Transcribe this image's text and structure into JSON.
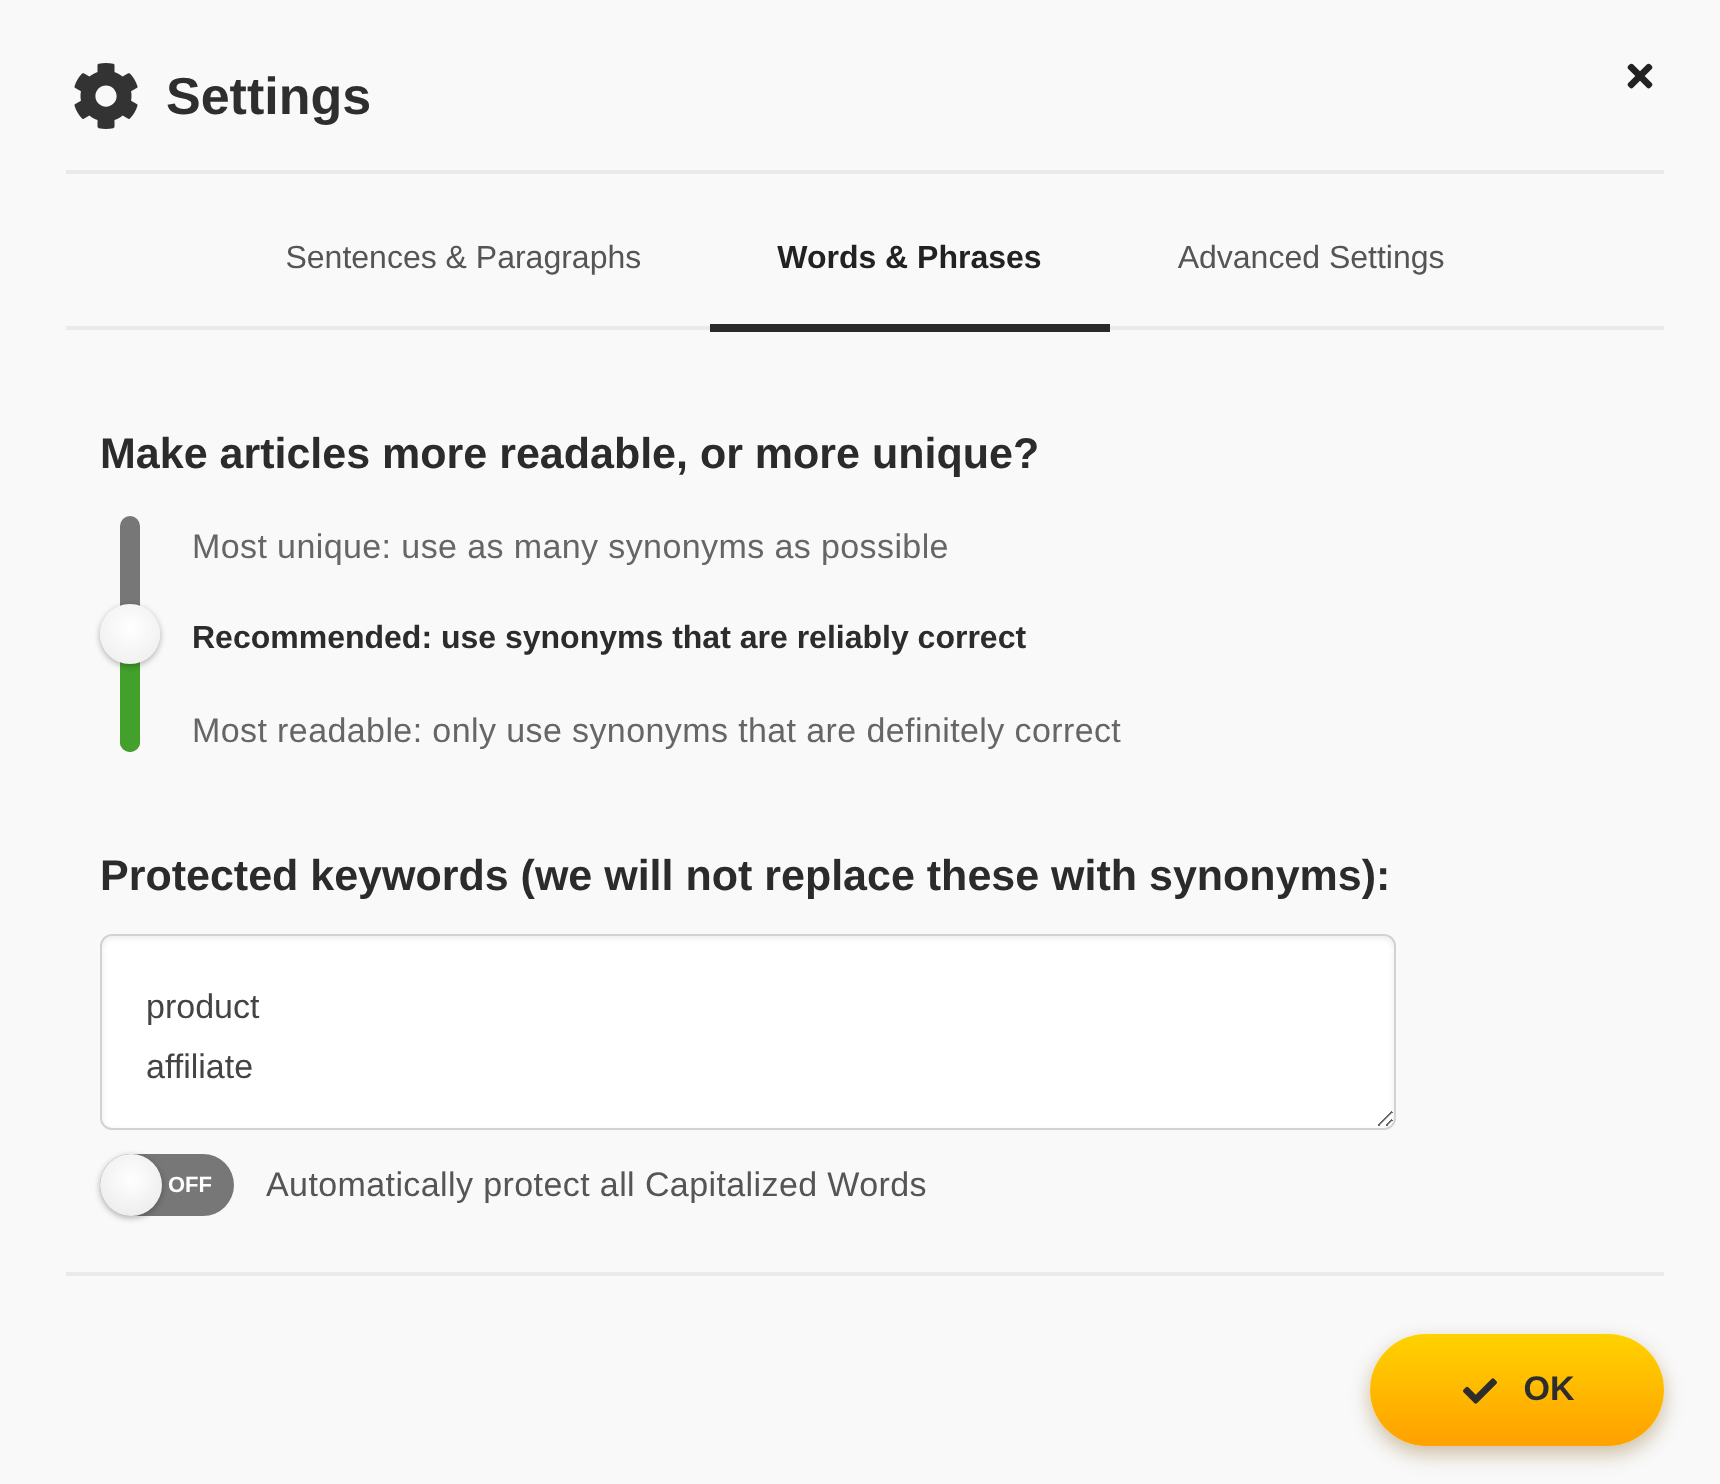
{
  "window": {
    "title": "Settings"
  },
  "tabs": [
    {
      "label": "Sentences & Paragraphs",
      "selected": false
    },
    {
      "label": "Words & Phrases",
      "selected": true
    },
    {
      "label": "Advanced Settings",
      "selected": false
    }
  ],
  "readability": {
    "heading": "Make articles more readable, or more unique?",
    "slider": {
      "level": 0.5
    },
    "options": [
      {
        "label": "Most unique: use as many synonyms as possible",
        "selected": false
      },
      {
        "label": "Recommended: use synonyms that are reliably correct",
        "selected": true
      },
      {
        "label": "Most readable: only use synonyms that are definitely correct",
        "selected": false
      }
    ]
  },
  "keywords": {
    "heading": "Protected keywords (we will not replace these with synonyms):",
    "value": "product\naffiliate",
    "toggle": {
      "on": false,
      "state_text": "OFF",
      "label": "Automatically protect all Capitalized Words"
    }
  },
  "buttons": [
    {
      "label": "OK"
    }
  ]
}
